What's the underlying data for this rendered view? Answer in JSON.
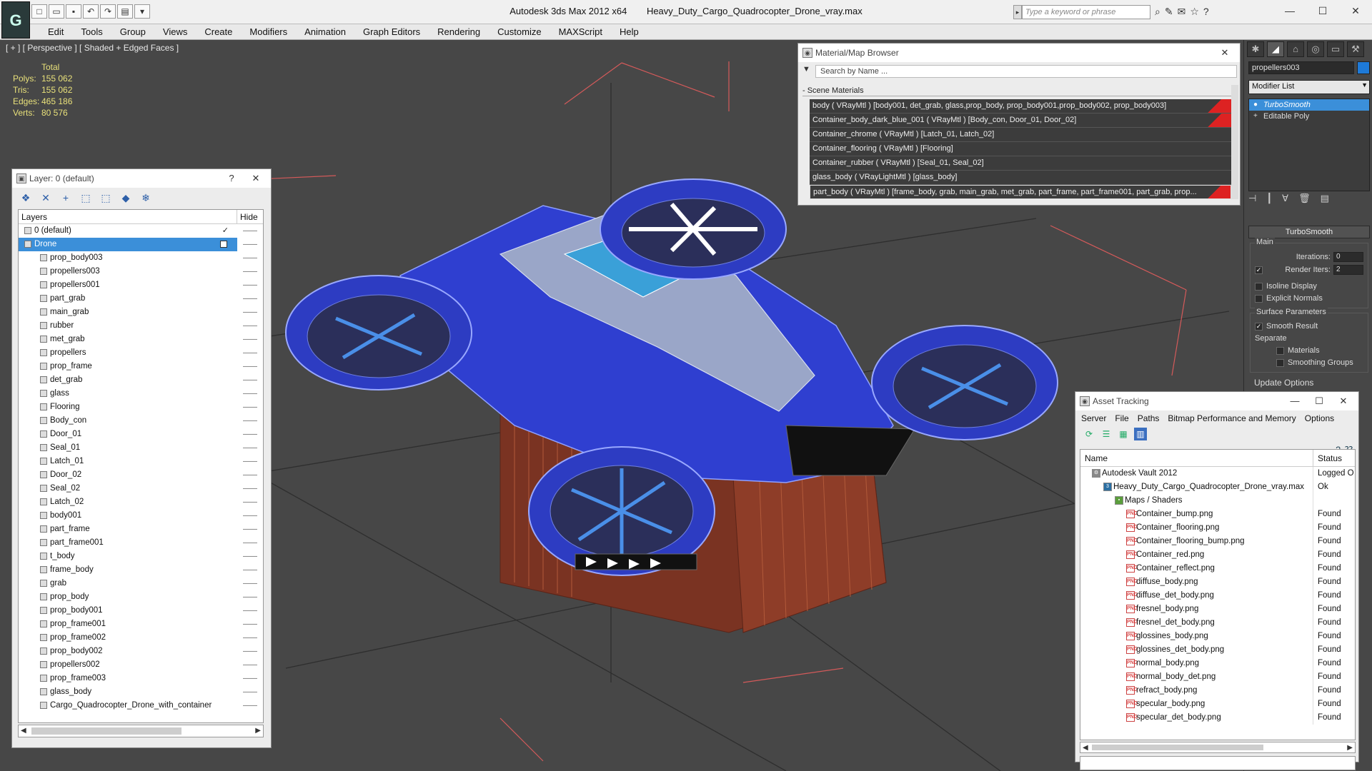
{
  "title": {
    "app": "Autodesk 3ds Max  2012 x64",
    "file": "Heavy_Duty_Cargo_Quadrocopter_Drone_vray.max",
    "search_placeholder": "Type a keyword or phrase",
    "logo": "G"
  },
  "menu": [
    "Edit",
    "Tools",
    "Group",
    "Views",
    "Create",
    "Modifiers",
    "Animation",
    "Graph Editors",
    "Rendering",
    "Customize",
    "MAXScript",
    "Help"
  ],
  "viewport": {
    "label": "[ + ] [ Perspective ] [ Shaded + Edged Faces ]",
    "stats_header": "Total",
    "stats": [
      {
        "key": "Polys:",
        "value": "155 062"
      },
      {
        "key": "Tris:",
        "value": "155 062"
      },
      {
        "key": "Edges:",
        "value": "465 186"
      },
      {
        "key": "Verts:",
        "value": "80 576"
      }
    ]
  },
  "layer_window": {
    "title": "Layer: 0 (default)",
    "help": "?",
    "col_layers": "Layers",
    "col_hide": "Hide",
    "rows": [
      {
        "name": "0 (default)",
        "level": 0,
        "checked": true
      },
      {
        "name": "Drone",
        "level": 0,
        "selected": true
      },
      {
        "name": "prop_body003",
        "level": 1
      },
      {
        "name": "propellers003",
        "level": 1
      },
      {
        "name": "propellers001",
        "level": 1
      },
      {
        "name": "part_grab",
        "level": 1
      },
      {
        "name": "main_grab",
        "level": 1
      },
      {
        "name": "rubber",
        "level": 1
      },
      {
        "name": "met_grab",
        "level": 1
      },
      {
        "name": "propellers",
        "level": 1
      },
      {
        "name": "prop_frame",
        "level": 1
      },
      {
        "name": "det_grab",
        "level": 1
      },
      {
        "name": "glass",
        "level": 1
      },
      {
        "name": "Flooring",
        "level": 1
      },
      {
        "name": "Body_con",
        "level": 1
      },
      {
        "name": "Door_01",
        "level": 1
      },
      {
        "name": "Seal_01",
        "level": 1
      },
      {
        "name": "Latch_01",
        "level": 1
      },
      {
        "name": "Door_02",
        "level": 1
      },
      {
        "name": "Seal_02",
        "level": 1
      },
      {
        "name": "Latch_02",
        "level": 1
      },
      {
        "name": "body001",
        "level": 1
      },
      {
        "name": "part_frame",
        "level": 1
      },
      {
        "name": "part_frame001",
        "level": 1
      },
      {
        "name": "t_body",
        "level": 1
      },
      {
        "name": "frame_body",
        "level": 1
      },
      {
        "name": "grab",
        "level": 1
      },
      {
        "name": "prop_body",
        "level": 1
      },
      {
        "name": "prop_body001",
        "level": 1
      },
      {
        "name": "prop_frame001",
        "level": 1
      },
      {
        "name": "prop_frame002",
        "level": 1
      },
      {
        "name": "prop_body002",
        "level": 1
      },
      {
        "name": "propellers002",
        "level": 1
      },
      {
        "name": "prop_frame003",
        "level": 1
      },
      {
        "name": "glass_body",
        "level": 1
      },
      {
        "name": "Cargo_Quadrocopter_Drone_with_container",
        "level": 1
      }
    ]
  },
  "material_browser": {
    "title": "Material/Map Browser",
    "search_placeholder": "Search by Name ...",
    "section": "- Scene Materials",
    "rows": [
      {
        "text": "body ( VRayMtl ) [body001, det_grab, glass,prop_body, prop_body001,prop_body002, prop_body003]",
        "flag": true
      },
      {
        "text": "Container_body_dark_blue_001  ( VRayMtl ) [Body_con, Door_01, Door_02]",
        "flag": true
      },
      {
        "text": "Container_chrome  ( VRayMtl ) [Latch_01, Latch_02]"
      },
      {
        "text": "Container_flooring  ( VRayMtl ) [Flooring]"
      },
      {
        "text": "Container_rubber  ( VRayMtl ) [Seal_01, Seal_02]"
      },
      {
        "text": "glass_body ( VRayLightMtl ) [glass_body]"
      },
      {
        "text": "part_body  ( VRayMtl ) [frame_body, grab, main_grab, met_grab, part_frame, part_frame001, part_grab, prop...",
        "hilite": true,
        "flag": true
      }
    ]
  },
  "command_panel": {
    "object_name": "propellers003",
    "object_color": "#1e7ad8",
    "modifier_list": "Modifier List",
    "stack": [
      {
        "label": "TurboSmooth",
        "selected": true
      },
      {
        "label": "Editable Poly"
      }
    ],
    "rollout_title": "TurboSmooth",
    "main_group": "Main",
    "iterations_label": "Iterations:",
    "iterations_value": "0",
    "render_iters_label": "Render Iters:",
    "render_iters_value": "2",
    "isoline": "Isoline Display",
    "explicit": "Explicit Normals",
    "surface_group": "Surface Parameters",
    "smooth_result": "Smooth Result",
    "separate_label": "Separate",
    "materials": "Materials",
    "smoothing_groups": "Smoothing Groups",
    "update_options": "Update Options"
  },
  "asset_tracking": {
    "title": "Asset Tracking",
    "menu": [
      "Server",
      "File",
      "Paths",
      "Bitmap Performance and Memory",
      "Options"
    ],
    "col_name": "Name",
    "col_status": "Status",
    "rows": [
      {
        "name": "Autodesk Vault 2012",
        "status": "Logged O",
        "indent": 1,
        "icon": "vault"
      },
      {
        "name": "Heavy_Duty_Cargo_Quadrocopter_Drone_vray.max",
        "status": "Ok",
        "indent": 2,
        "icon": "max"
      },
      {
        "name": "Maps / Shaders",
        "status": "",
        "indent": 3,
        "icon": "folder"
      },
      {
        "name": "Container_bump.png",
        "status": "Found",
        "indent": 4,
        "icon": "png"
      },
      {
        "name": "Container_flooring.png",
        "status": "Found",
        "indent": 4,
        "icon": "png"
      },
      {
        "name": "Container_flooring_bump.png",
        "status": "Found",
        "indent": 4,
        "icon": "png"
      },
      {
        "name": "Container_red.png",
        "status": "Found",
        "indent": 4,
        "icon": "png"
      },
      {
        "name": "Container_reflect.png",
        "status": "Found",
        "indent": 4,
        "icon": "png"
      },
      {
        "name": "diffuse_body.png",
        "status": "Found",
        "indent": 4,
        "icon": "png"
      },
      {
        "name": "diffuse_det_body.png",
        "status": "Found",
        "indent": 4,
        "icon": "png"
      },
      {
        "name": "fresnel_body.png",
        "status": "Found",
        "indent": 4,
        "icon": "png"
      },
      {
        "name": "fresnel_det_body.png",
        "status": "Found",
        "indent": 4,
        "icon": "png"
      },
      {
        "name": "glossines_body.png",
        "status": "Found",
        "indent": 4,
        "icon": "png"
      },
      {
        "name": "glossines_det_body.png",
        "status": "Found",
        "indent": 4,
        "icon": "png"
      },
      {
        "name": "normal_body.png",
        "status": "Found",
        "indent": 4,
        "icon": "png"
      },
      {
        "name": "normal_body_det.png",
        "status": "Found",
        "indent": 4,
        "icon": "png"
      },
      {
        "name": "refract_body.png",
        "status": "Found",
        "indent": 4,
        "icon": "png"
      },
      {
        "name": "specular_body.png",
        "status": "Found",
        "indent": 4,
        "icon": "png"
      },
      {
        "name": "specular_det_body.png",
        "status": "Found",
        "indent": 4,
        "icon": "png"
      }
    ]
  },
  "colors": {
    "selection": "#3b8fd9",
    "drone_body": "#2f3fd0",
    "container": "#8a3a26",
    "viewport_bg": "#474747"
  }
}
